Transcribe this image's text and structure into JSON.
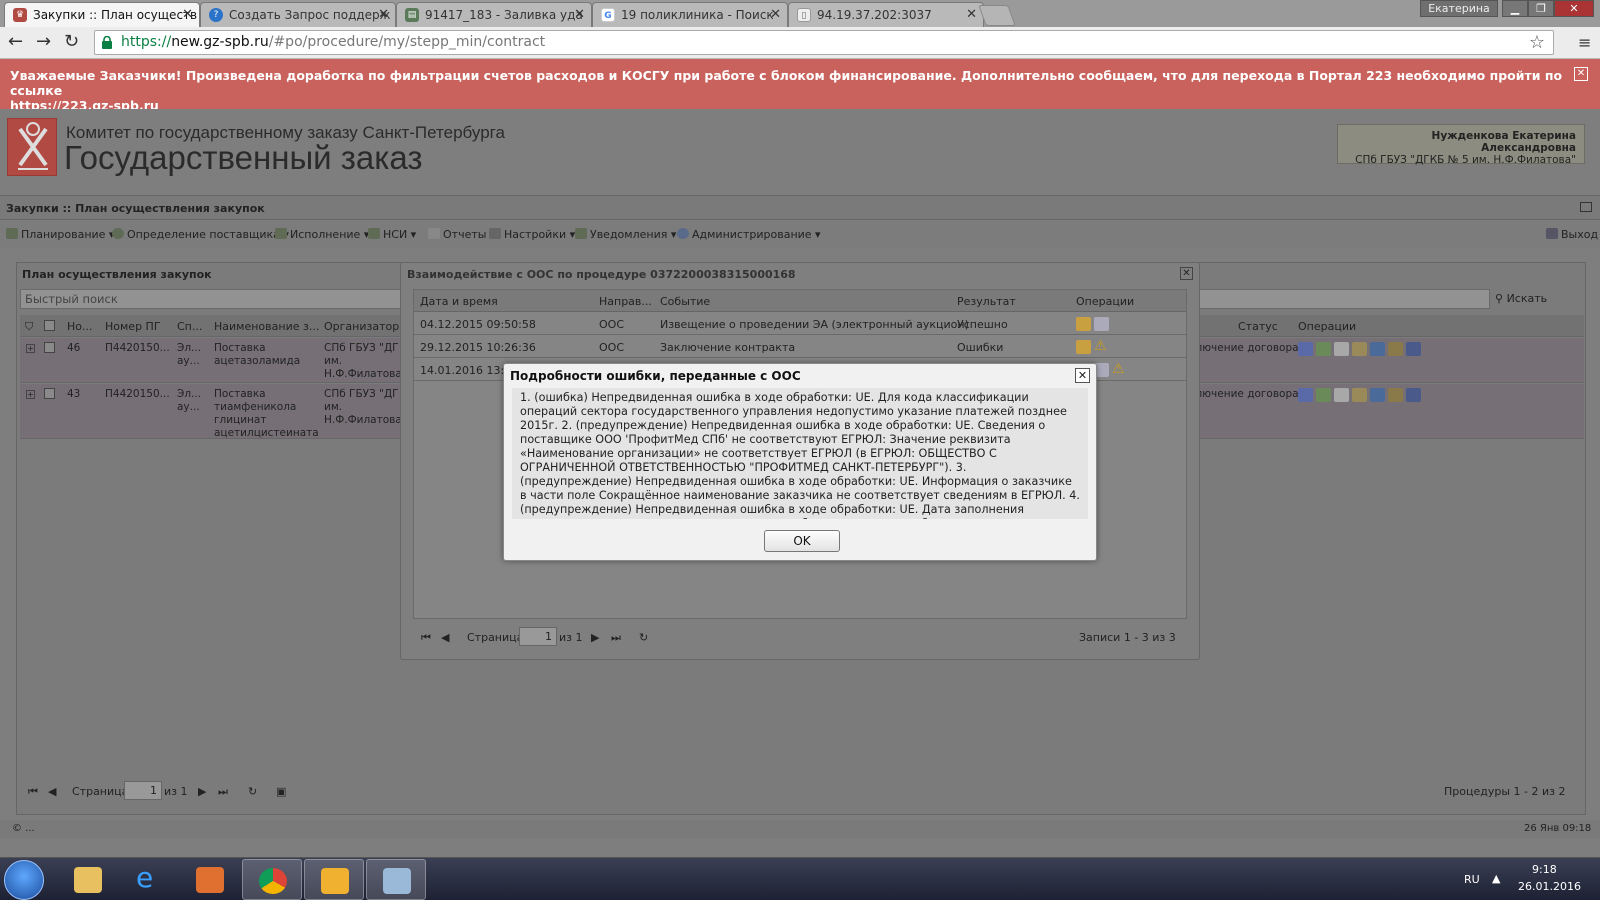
{
  "browser": {
    "tabs": [
      {
        "label": "Закупки :: План осуществ",
        "active": true
      },
      {
        "label": "Создать Запрос поддерж"
      },
      {
        "label": "91417_183 - Заливка уда"
      },
      {
        "label": "19 поликлиника - Поиск"
      },
      {
        "label": "94.19.37.202:3037"
      }
    ],
    "user": "Екатерина",
    "url_scheme": "https://",
    "url_host": "new.gz-spb.ru",
    "url_path": "/#po/procedure/my/stepp_min/contract"
  },
  "banner": {
    "text": "Уважаемые Заказчики! Произведена доработка по фильтрации счетов расходов и КОСГУ при работе с блоком финансирование. Дополнительно сообщаем, что для перехода в Портал 223 необходимо пройти по ссылке",
    "link": "https://223.gz-spb.ru"
  },
  "header": {
    "committee": "Комитет по государственному заказу Санкт-Петербурга",
    "system": "Государственный заказ",
    "user_name": "Нужденкова Екатерина Александровна",
    "user_org": "СПб ГБУЗ \"ДГКБ № 5 им. Н.Ф.Филатова\""
  },
  "panel_title": "Закупки :: План осуществления закупок",
  "menu": {
    "items": [
      "Планирование",
      "Определение поставщика",
      "Исполнение",
      "НСИ",
      "Отчеты",
      "Настройки",
      "Уведомления",
      "Администрирование"
    ],
    "exit": "Выход"
  },
  "grid": {
    "title": "План осуществления закупок",
    "search_placeholder": "Быстрый поиск",
    "search_button": "Искать",
    "columns": [
      "Но...",
      "Номер ПГ",
      "Сп...",
      "Наименование з...",
      "Организатор",
      "Статус",
      "Операции"
    ],
    "rows": [
      {
        "no": "46",
        "pg": "П4420150...",
        "sp": "Эл... ау...",
        "name": "Поставка ацетазоламида",
        "org": "СПб ГБУЗ \"ДГ 5 им. Н.Ф.Филатова",
        "status": "Заключение договора"
      },
      {
        "no": "43",
        "pg": "П4420150...",
        "sp": "Эл... ау...",
        "name": "Поставка тиамфеникола глицинат ацетилцистеината",
        "org": "СПб ГБУЗ \"ДГ 5 им. Н.Ф.Филатова",
        "status": "Заключение договора"
      }
    ],
    "pager": {
      "page_label": "Страница",
      "page": "1",
      "of": "из 1",
      "summary": "Процедуры 1 - 2 из 2"
    }
  },
  "status_bar": {
    "left": "© ...",
    "right": "26 Янв 09:18"
  },
  "dialog_oos": {
    "title": "Взаимодействие с ООС по процедуре 0372200038315000168",
    "columns": [
      "Дата и время",
      "Направ...",
      "Событие",
      "Результат",
      "Операции"
    ],
    "rows": [
      {
        "date": "04.12.2015 09:50:58",
        "dir": "ООС",
        "event": "Извещение о проведении ЭА (электронный аукцион)",
        "result": "Успешно"
      },
      {
        "date": "29.12.2015 10:26:36",
        "dir": "ООС",
        "event": "Заключение контракта",
        "result": "Ошибки"
      },
      {
        "date": "14.01.2016 13:31",
        "dir": "",
        "event": "",
        "result": ""
      }
    ],
    "pager": {
      "page_label": "Страница",
      "page": "1",
      "of": "из 1",
      "summary": "Записи 1 - 3 из 3"
    }
  },
  "dialog_error": {
    "title": "Подробности ошибки, переданные с ООС",
    "message": "1. (ошибка) Непредвиденная ошибка в ходе обработки: UE. Для кода классификации операций сектора государственного управления недопустимо указание платежей позднее 2015г. 2. (предупреждение) Непредвиденная ошибка в ходе обработки: UE. Сведения о поставщике ООО 'ПрофитМед СПб' не соответствуют ЕГРЮЛ: Значение реквизита «Наименование организации» не соответствует ЕГРЮЛ (в ЕГРЮЛ: ОБЩЕСТВО С ОГРАНИЧЕННОЙ ОТВЕТСТВЕННОСТЬЮ \"ПРОФИТМЕД САНКТ-ПЕТЕРБУРГ\"). 3. (предупреждение) Непредвиденная ошибка в ходе обработки: UE. Информация о заказчике в части поле Сокращённое наименование заказчика не соответствует сведениям в ЕГРЮЛ. 4. (предупреждение) Непредвиденная ошибка в ходе обработки: UE. Дата заполнения документа позже даты заключения контракта более чем на три рабочих дня",
    "ok": "OK"
  },
  "taskbar": {
    "lang": "RU",
    "time": "9:18",
    "date": "26.01.2016"
  },
  "colors": {
    "banner": "#c9625d",
    "accent": "#0b8043"
  }
}
